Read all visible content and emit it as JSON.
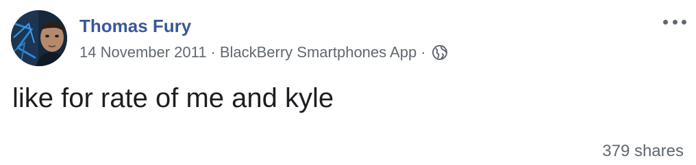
{
  "post": {
    "author_name": "Thomas Fury",
    "date": "14 November 2011",
    "separator": "·",
    "app_name": "BlackBerry Smartphones App",
    "privacy_icon": "globe-icon",
    "more_icon": "more-options-icon",
    "text": "like for rate of me and kyle",
    "shares": "379 shares"
  },
  "colors": {
    "author": "#385898",
    "meta": "#606770",
    "text": "#1c1e21",
    "background": "#ffffff"
  }
}
